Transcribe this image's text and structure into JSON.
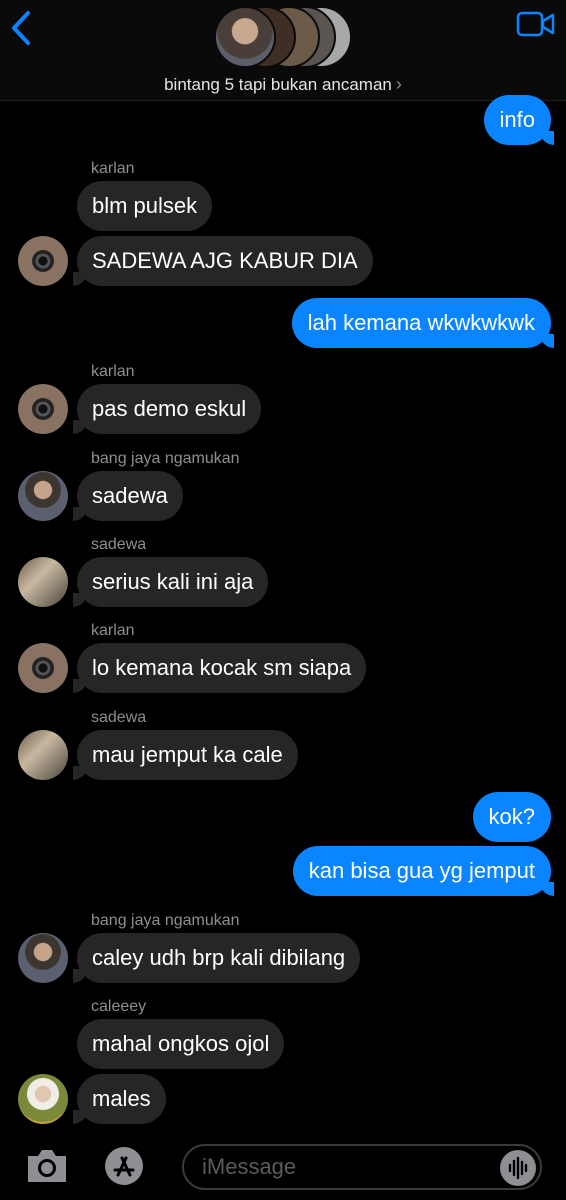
{
  "header": {
    "group_name": "bintang 5 tapi bukan ancaman",
    "chevron": "›",
    "back_icon": "chevron-left-icon",
    "video_icon": "video-camera-icon",
    "accent": "#0a84ff"
  },
  "messages": [
    {
      "side": "out",
      "text": "info"
    },
    {
      "side": "in",
      "sender": "karlan",
      "text": "blm pulsek"
    },
    {
      "side": "in",
      "text": "SADEWA AJG KABUR DIA"
    },
    {
      "side": "out",
      "text": "lah kemana wkwkwkwk"
    },
    {
      "side": "in",
      "sender": "karlan",
      "text": "pas demo eskul"
    },
    {
      "side": "in",
      "sender": "bang jaya ngamukan",
      "text": "sadewa"
    },
    {
      "side": "in",
      "sender": "sadewa",
      "text": "serius kali ini aja"
    },
    {
      "side": "in",
      "sender": "karlan",
      "text": "lo kemana kocak sm siapa"
    },
    {
      "side": "in",
      "sender": "sadewa",
      "text": "mau jemput ka cale"
    },
    {
      "side": "out",
      "text": "kok?"
    },
    {
      "side": "out",
      "text": "kan bisa gua yg jemput"
    },
    {
      "side": "in",
      "sender": "bang jaya ngamukan",
      "text": "caley udh brp kali dibilang"
    },
    {
      "side": "in",
      "sender": "caleeey",
      "text": "mahal ongkos ojol"
    },
    {
      "side": "in",
      "text": "males"
    }
  ],
  "composer": {
    "placeholder": "iMessage",
    "camera_icon": "camera-icon",
    "appstore_icon": "app-store-icon",
    "audio_icon": "audio-waveform-icon"
  },
  "colors": {
    "background": "#000000",
    "incoming_bubble": "#262628",
    "outgoing_bubble": "#0a84ff",
    "sender_label": "#8e8e93"
  }
}
